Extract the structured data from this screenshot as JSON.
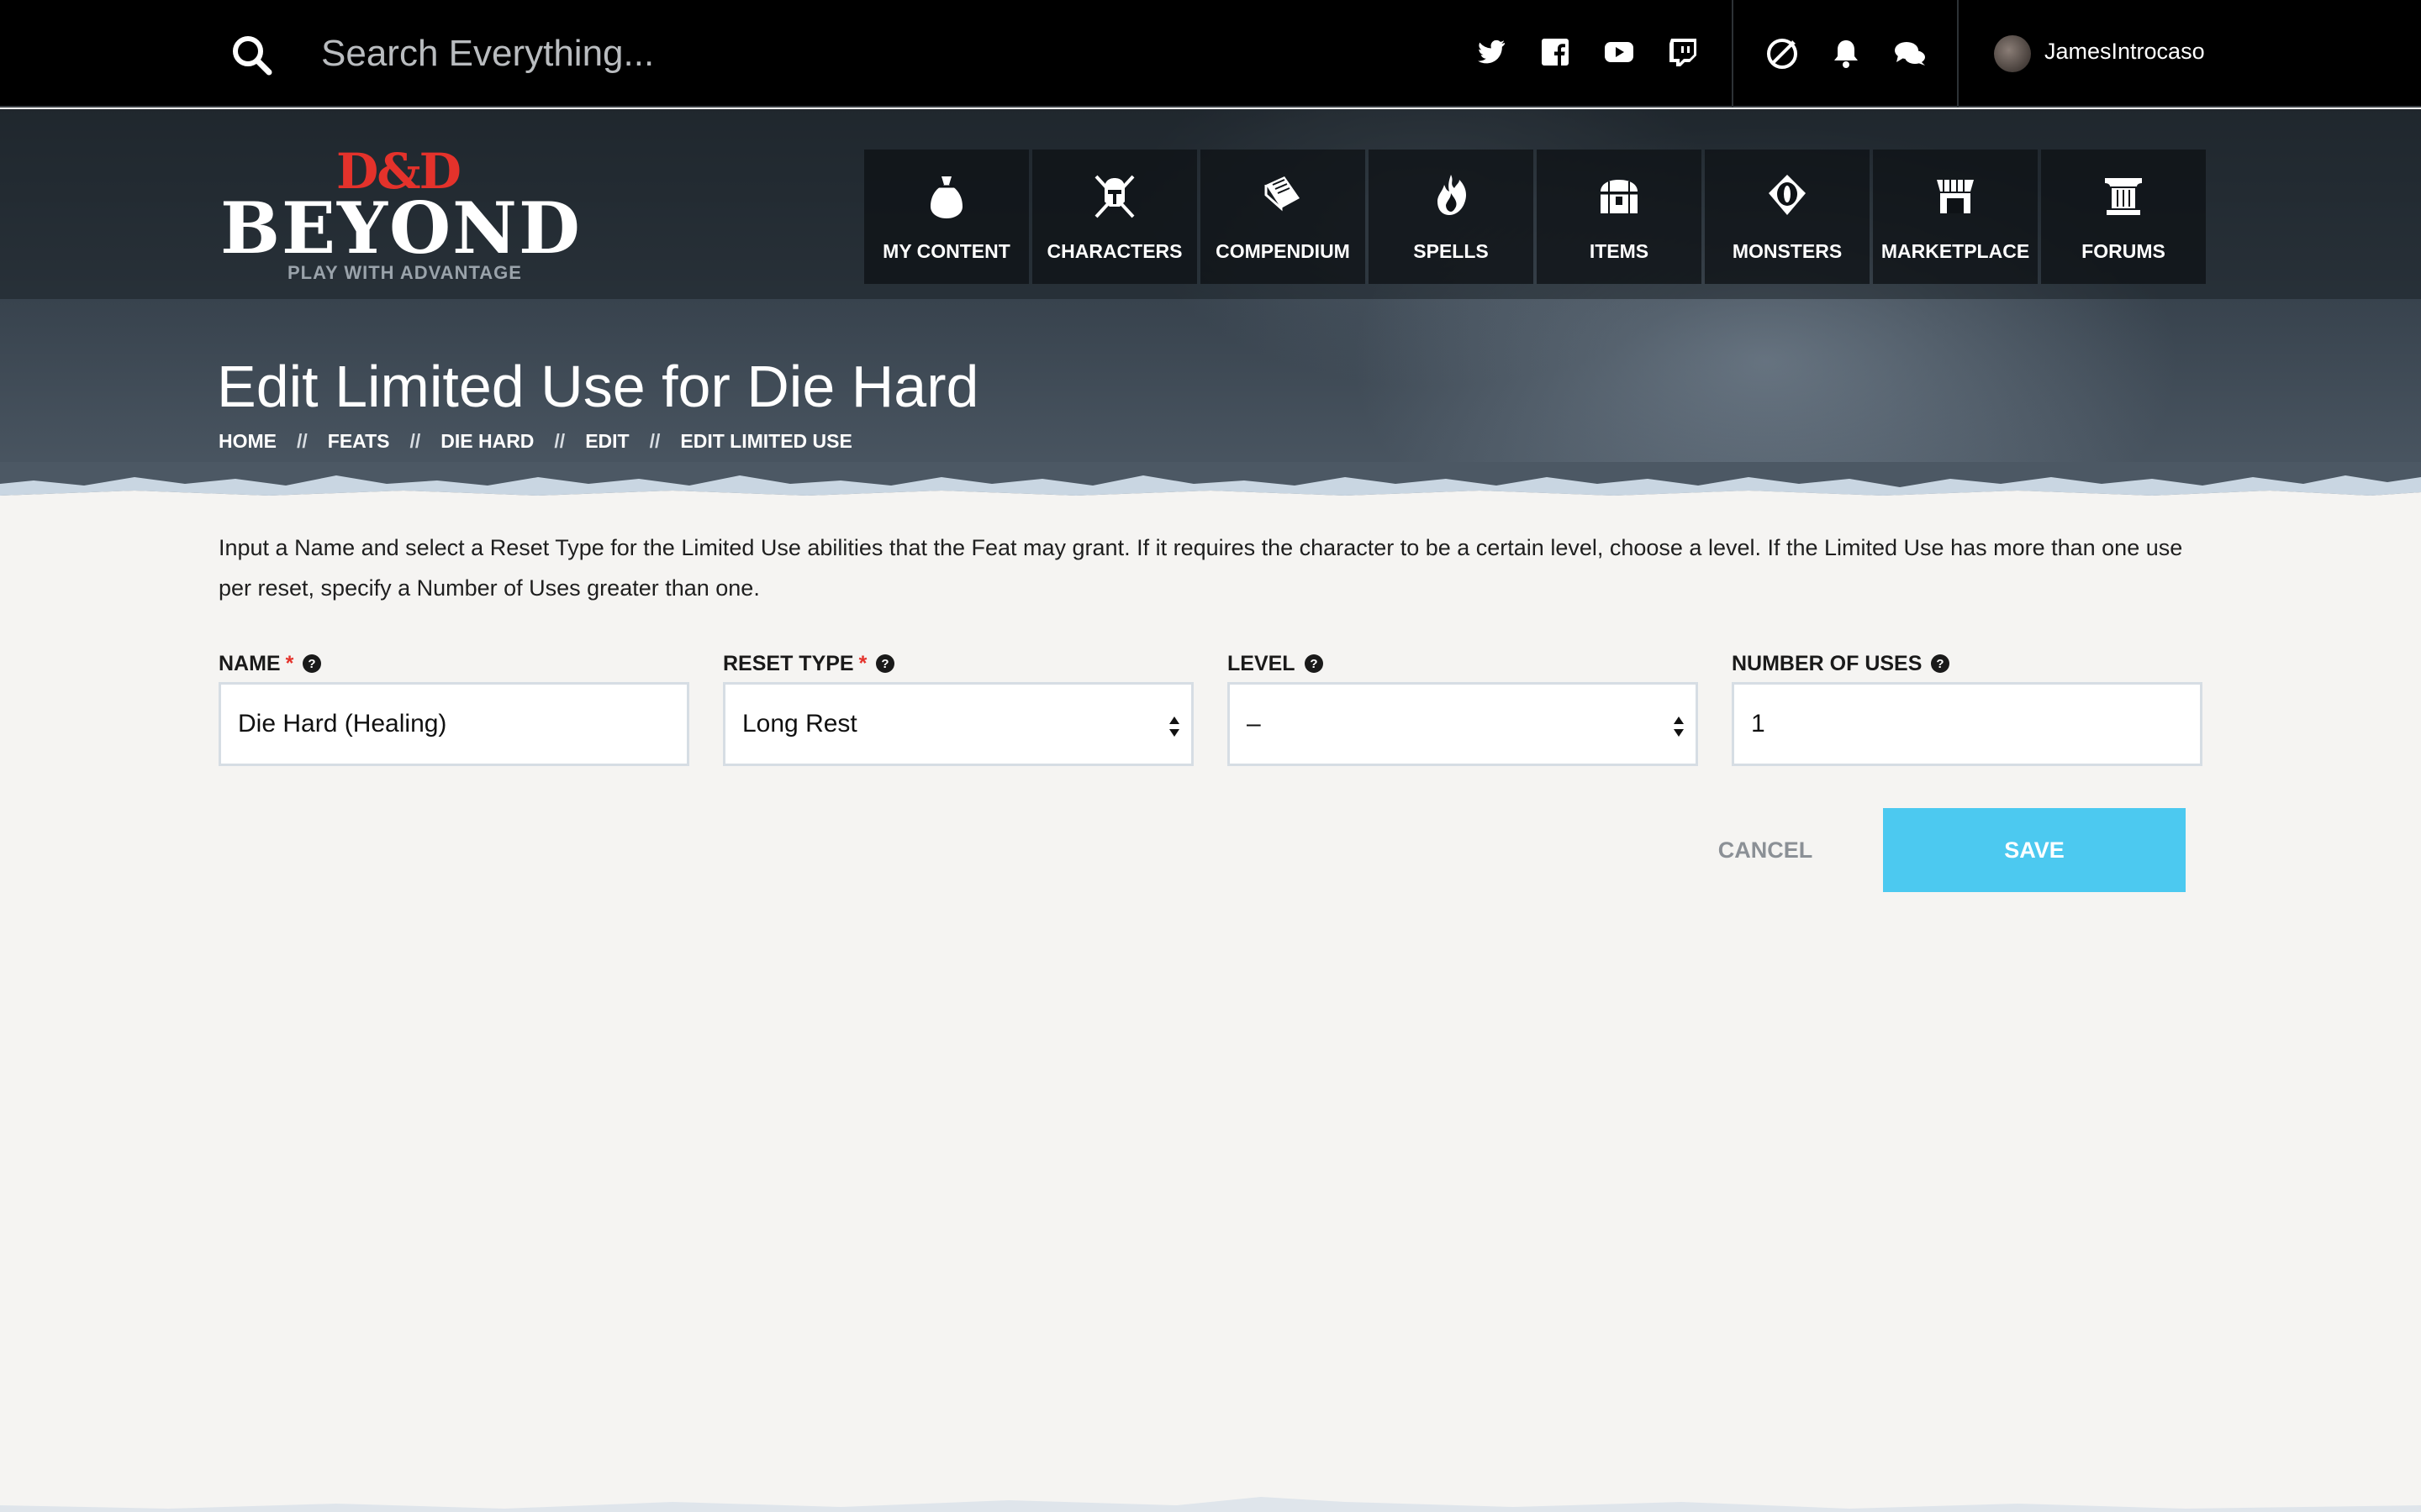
{
  "topbar": {
    "search_placeholder": "Search Everything...",
    "social": [
      "twitter-icon",
      "facebook-icon",
      "youtube-icon",
      "twitch-icon"
    ],
    "utilities": [
      "dice-icon",
      "bell-icon",
      "chat-icon"
    ],
    "username": "JamesIntrocaso"
  },
  "logo": {
    "mark": "D&D",
    "name": "BEYOND",
    "tagline": "PLAY WITH ADVANTAGE"
  },
  "nav": [
    {
      "label": "MY CONTENT",
      "icon": "bag-icon"
    },
    {
      "label": "CHARACTERS",
      "icon": "helmet-crossed-swords-icon"
    },
    {
      "label": "COMPENDIUM",
      "icon": "book-icon"
    },
    {
      "label": "SPELLS",
      "icon": "flame-hand-icon"
    },
    {
      "label": "ITEMS",
      "icon": "chest-icon"
    },
    {
      "label": "MONSTERS",
      "icon": "monster-eye-icon"
    },
    {
      "label": "MARKETPLACE",
      "icon": "shop-icon"
    },
    {
      "label": "FORUMS",
      "icon": "pillar-icon"
    }
  ],
  "page": {
    "title": "Edit Limited Use for Die Hard",
    "breadcrumb": [
      "HOME",
      "FEATS",
      "DIE HARD",
      "EDIT",
      "EDIT LIMITED USE"
    ],
    "breadcrumb_sep": "//",
    "intro": "Input a Name and select a Reset Type for the Limited Use abilities that the Feat may grant. If it requires the character to be a certain level, choose a level. If the Limited Use has more than one use per reset, specify a Number of Uses greater than one."
  },
  "form": {
    "name": {
      "label": "NAME",
      "required": "*",
      "value": "Die Hard (Healing)"
    },
    "reset_type": {
      "label": "RESET TYPE",
      "required": "*",
      "value": "Long Rest"
    },
    "level": {
      "label": "LEVEL",
      "value": "–"
    },
    "uses": {
      "label": "NUMBER OF USES",
      "value": "1"
    },
    "cancel_label": "CANCEL",
    "save_label": "SAVE"
  },
  "colors": {
    "accent": "#4cc9f0",
    "required": "#e4322b",
    "brand_red": "#e4322b",
    "topbar": "#000000"
  }
}
